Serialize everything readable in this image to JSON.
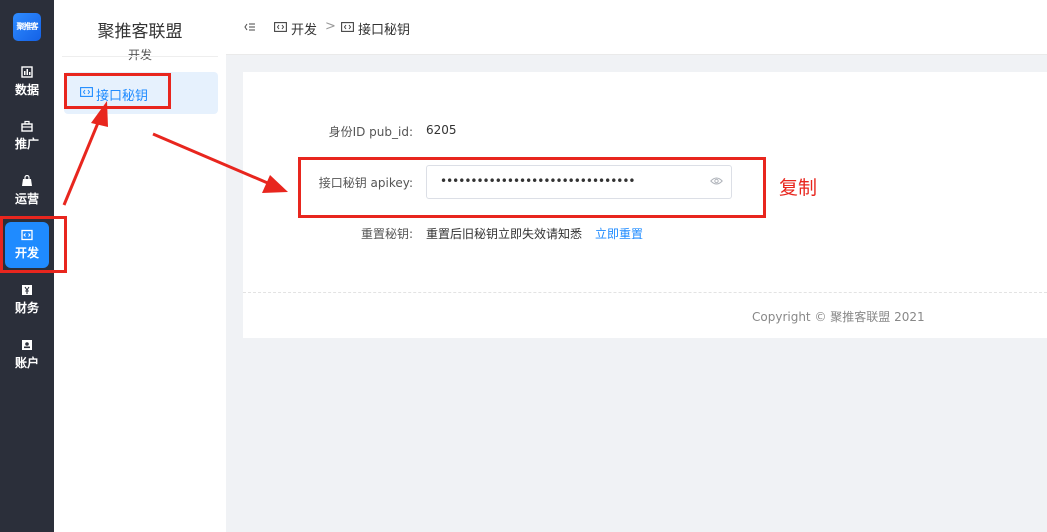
{
  "rail": {
    "logo_text": "聚推客",
    "items": [
      {
        "label": "数据",
        "icon": "bar-chart-icon"
      },
      {
        "label": "推广",
        "icon": "briefcase-icon"
      },
      {
        "label": "运营",
        "icon": "bag-icon"
      },
      {
        "label": "开发",
        "icon": "code-icon",
        "active": true
      },
      {
        "label": "财务",
        "icon": "yen-icon"
      },
      {
        "label": "账户",
        "icon": "user-card-icon"
      }
    ]
  },
  "submenu": {
    "title": "聚推客联盟",
    "caption": "开发",
    "items": [
      {
        "label": "接口秘钥",
        "icon": "code-icon",
        "active": true
      }
    ]
  },
  "breadcrumb": {
    "items": [
      "开发",
      "接口秘钥"
    ],
    "separator": ">"
  },
  "form": {
    "pub_id_label": "身份ID pub_id:",
    "pub_id_value": "6205",
    "apikey_label": "接口秘钥 apikey:",
    "apikey_value": "••••••••••••••••••••••••••••••••",
    "reset_label": "重置秘钥:",
    "reset_hint": "重置后旧秘钥立即失效请知悉",
    "reset_link": "立即重置"
  },
  "footer": {
    "copyright": "Copyright © 聚推客联盟 2021"
  },
  "annotation": {
    "text": "复制"
  },
  "colors": {
    "accent": "#1f8bff",
    "annotation": "#e8261e",
    "rail_bg": "#2b2f3a"
  }
}
